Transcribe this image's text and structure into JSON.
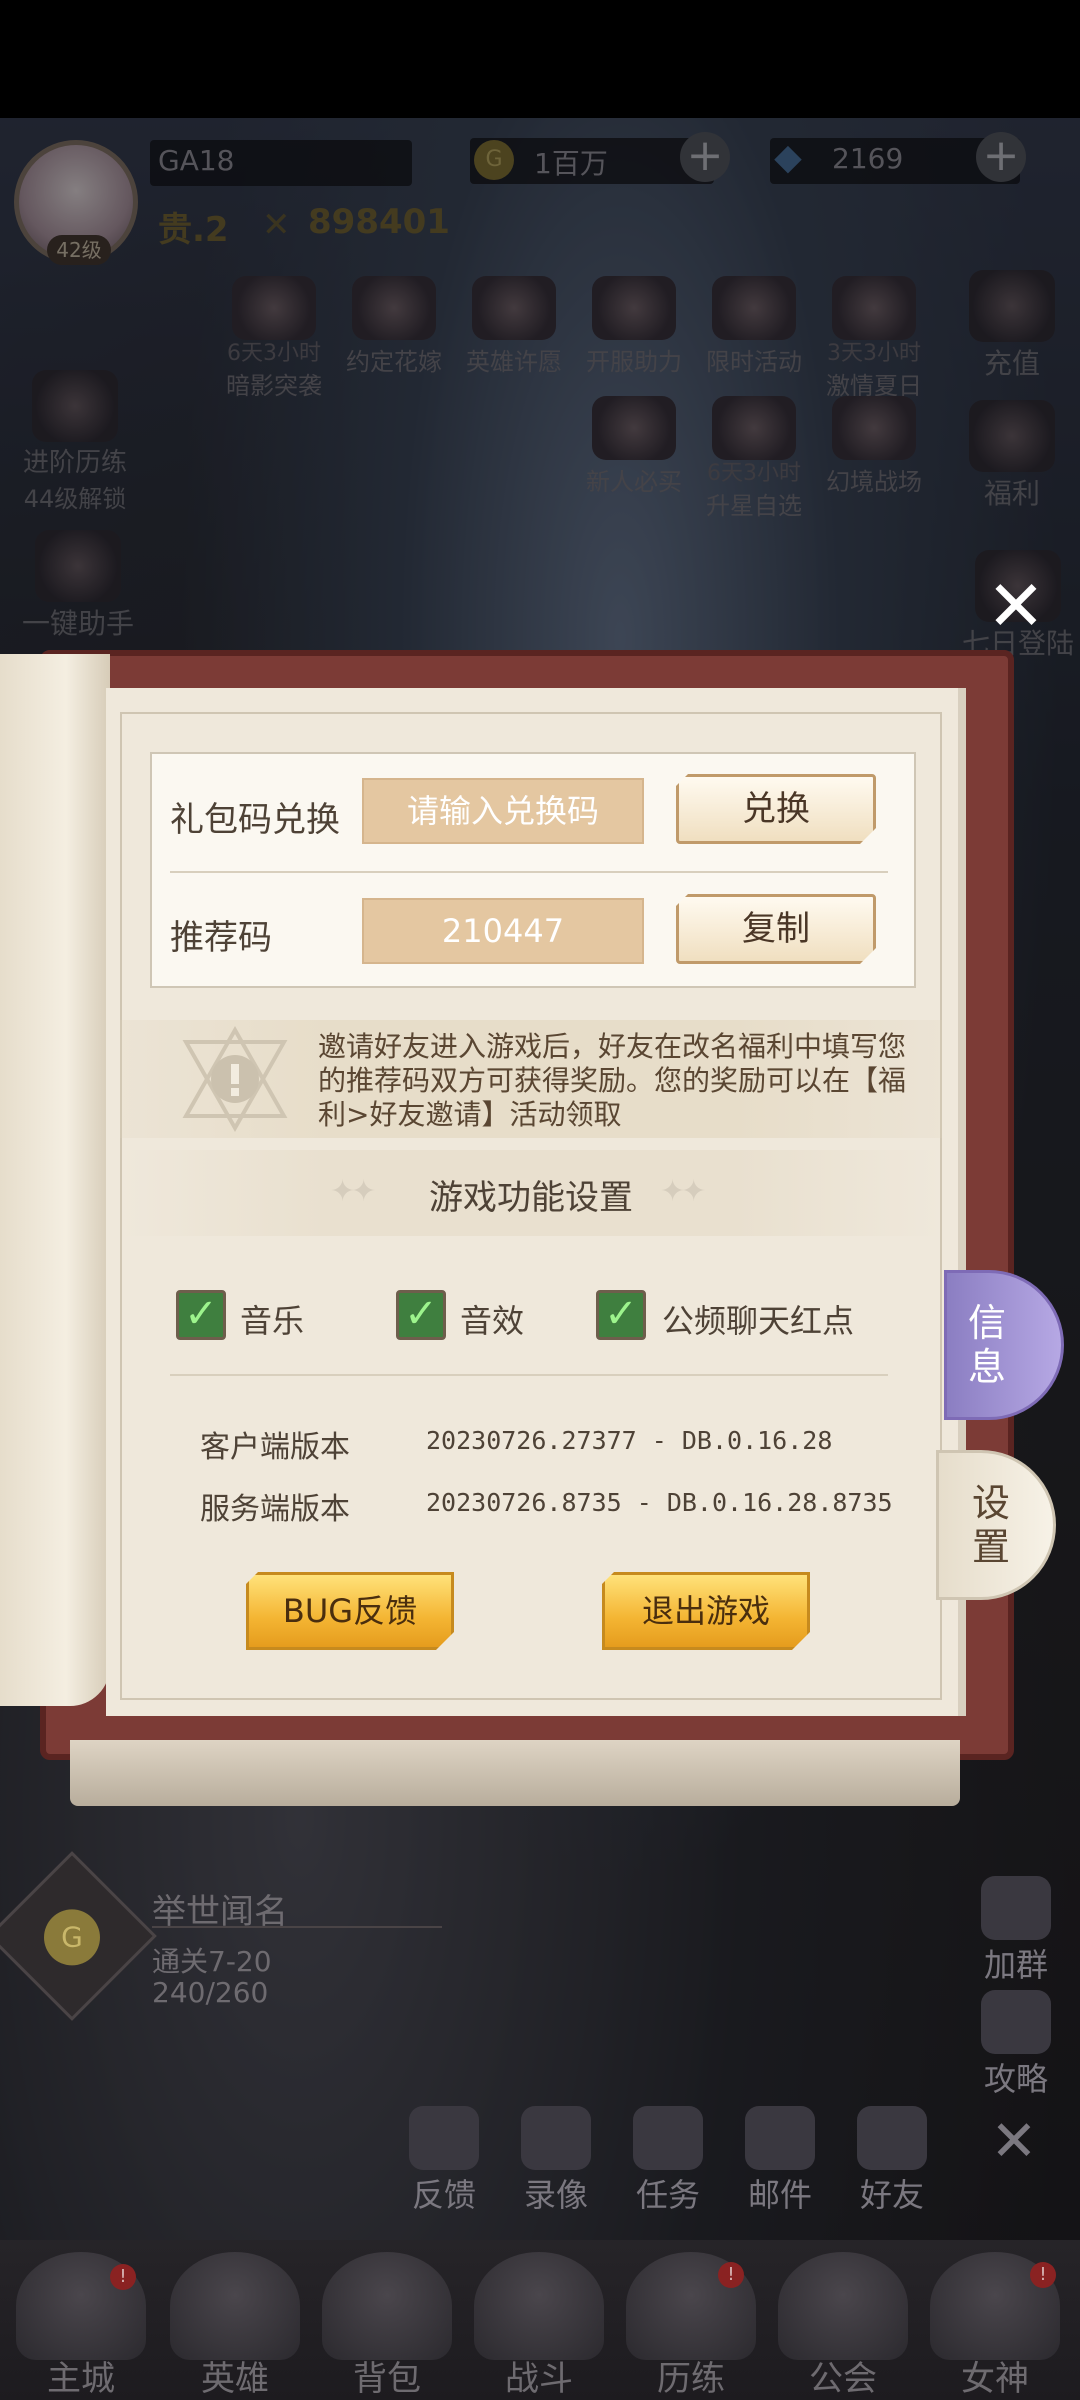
{
  "hud": {
    "player_name": "GA18",
    "level": "42级",
    "gold": "1百万",
    "gems": "2169",
    "rank": "贵.2",
    "power": "898401"
  },
  "activities_row1": [
    {
      "timer": "6天3小时",
      "label": "暗影突袭"
    },
    {
      "timer": "",
      "label": "约定花嫁"
    },
    {
      "timer": "",
      "label": "英雄许愿"
    },
    {
      "timer": "",
      "label": "开服助力"
    },
    {
      "timer": "",
      "label": "限时活动"
    },
    {
      "timer": "3天3小时",
      "label": "激情夏日"
    }
  ],
  "activities_row2": [
    {
      "timer": "",
      "label": "新人必买"
    },
    {
      "timer": "6天3小时",
      "label": "升星自选"
    },
    {
      "timer": "",
      "label": "幻境战场"
    }
  ],
  "left_side": {
    "advance_label": "进阶历练",
    "advance_sub": "44级解锁",
    "assistant_label": "一键助手"
  },
  "right_side": [
    "充值",
    "福利",
    "七日登陆"
  ],
  "dialog": {
    "gift_code_label": "礼包码兑换",
    "gift_code_placeholder": "请输入兑换码",
    "redeem_button": "兑换",
    "referral_label": "推荐码",
    "referral_code": "210447",
    "copy_button": "复制",
    "notice": "邀请好友进入游戏后，好友在改名福利中填写您的推荐码双方可获得奖励。您的奖励可以在【福利>好友邀请】活动领取",
    "settings_title": "游戏功能设置",
    "toggles": [
      {
        "label": "音乐",
        "checked": true
      },
      {
        "label": "音效",
        "checked": true
      },
      {
        "label": "公频聊天红点",
        "checked": true
      }
    ],
    "client_version_label": "客户端版本",
    "client_version": "20230726.27377 - DB.0.16.28",
    "server_version_label": "服务端版本",
    "server_version": "20230726.8735 - DB.0.16.28.8735",
    "bug_button": "BUG反馈",
    "exit_button": "退出游戏"
  },
  "tabs": {
    "info": "信息",
    "settings": "设置"
  },
  "quest": {
    "title": "举世闻名",
    "stage": "通关7-20",
    "progress": "240/260"
  },
  "right_lower": [
    "加群",
    "攻略"
  ],
  "shortcuts": [
    "反馈",
    "录像",
    "任务",
    "邮件",
    "好友"
  ],
  "bottom_nav": [
    "主城",
    "英雄",
    "背包",
    "战斗",
    "历练",
    "公会",
    "女神"
  ],
  "colors": {
    "page": "#efe8db",
    "accent_gold": "#f4b533",
    "check_green": "#3f7f3f",
    "tab_info": "#8b7ec2"
  }
}
